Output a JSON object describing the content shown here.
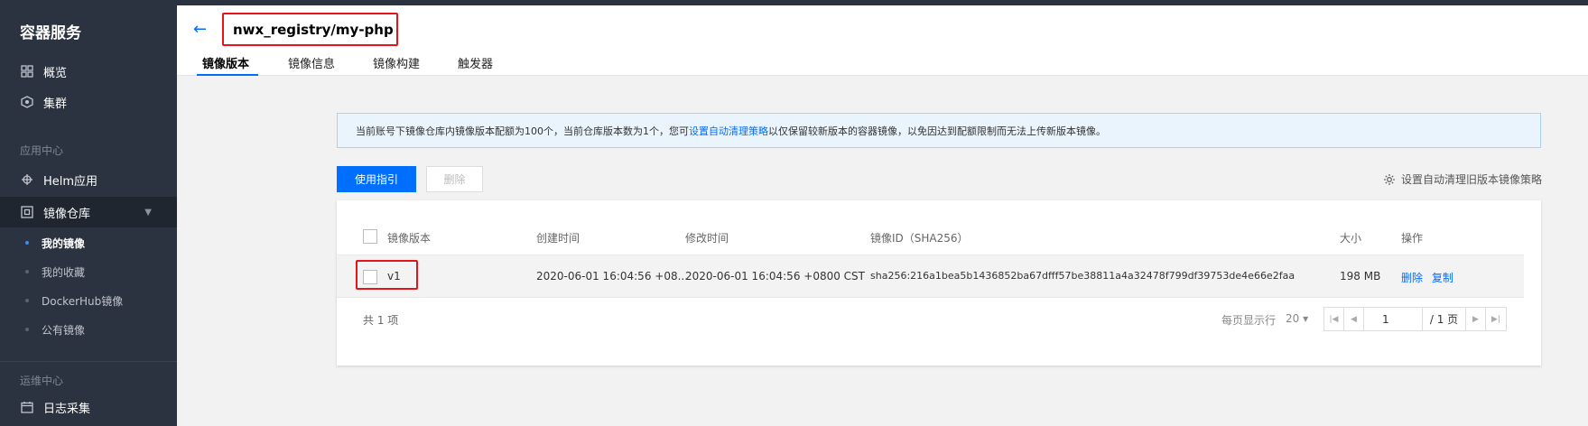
{
  "sidebar": {
    "brand": "容器服务",
    "overview": "概览",
    "cluster": "集群",
    "app_center_label": "应用中心",
    "helm": "Helm应用",
    "image_repo": "镜像仓库",
    "sub_items": [
      "我的镜像",
      "我的收藏",
      "DockerHub镜像",
      "公有镜像"
    ],
    "ops_center_label": "运维中心",
    "log_collection": "日志采集"
  },
  "header": {
    "back_icon": "←",
    "title": "nwx_registry/my-php",
    "tabs": [
      "镜像版本",
      "镜像信息",
      "镜像构建",
      "触发器"
    ]
  },
  "notice": {
    "text_before": "当前账号下镜像仓库内镜像版本配额为100个，当前仓库版本数为1个，您可",
    "link": "设置自动清理策略",
    "text_after": "以仅保留较新版本的容器镜像，以免因达到配额限制而无法上传新版本镜像。"
  },
  "toolbar": {
    "guide_button": "使用指引",
    "delete_button": "删除",
    "policy_link": "设置自动清理旧版本镜像策略"
  },
  "table": {
    "headers": [
      "镜像版本",
      "创建时间",
      "修改时间",
      "镜像ID（SHA256）",
      "大小",
      "操作"
    ],
    "rows": [
      {
        "version": "v1",
        "created": "2020-06-01 16:04:56 +08...",
        "modified": "2020-06-01 16:04:56 +0800 CST",
        "image_id": "sha256:216a1bea5b1436852ba67dfff57be38811a4a32478f799df39753de4e66e2faa",
        "size": "198 MB",
        "action_delete": "删除",
        "action_copy": "复制"
      }
    ]
  },
  "pagination": {
    "total": "共 1 项",
    "per_page_label": "每页显示行",
    "per_page_value": "20 ▾",
    "current_page": "1",
    "total_pages": "/ 1 页"
  },
  "colors": {
    "accent": "#006eff",
    "sidebar_bg": "#2b3340",
    "highlight": "#e5131b"
  }
}
